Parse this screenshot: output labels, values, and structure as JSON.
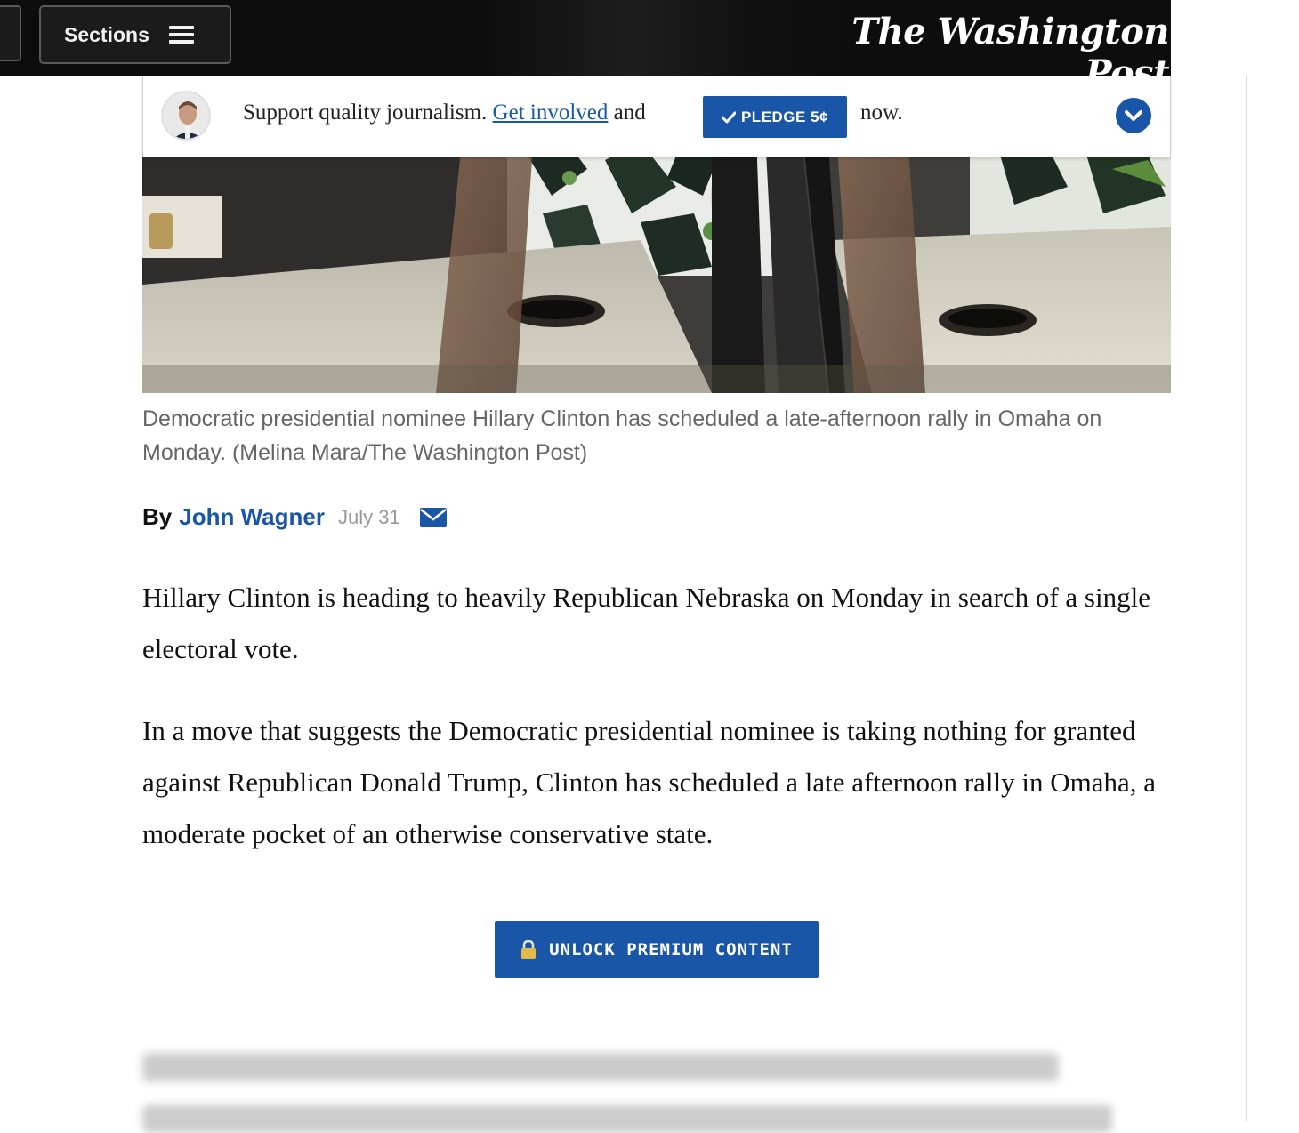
{
  "header": {
    "sections_label": "Sections",
    "logo_text": "The Washington Post"
  },
  "support_banner": {
    "text_before": "Support quality journalism. ",
    "link_text": "Get involved",
    "text_after": " and",
    "pledge_label": "PLEDGE 5¢",
    "text_end": "now."
  },
  "photo": {
    "caption": "Democratic presidential nominee Hillary Clinton has scheduled a late-afternoon rally in Omaha on Monday. (Melina Mara/The Washington Post)"
  },
  "byline": {
    "by_label": "By",
    "author": "John Wagner",
    "date": "July 31"
  },
  "article": {
    "paragraphs": [
      "Hillary Clinton is heading to heavily Republican Nebraska on Monday in search of a single electoral vote.",
      "In a move that suggests the Democratic presidential nominee is taking nothing for granted against Republican Donald Trump, Clinton has scheduled a late afternoon rally in Omaha, a moderate pocket of an otherwise conservative state."
    ]
  },
  "paywall": {
    "unlock_label": "UNLOCK PREMIUM CONTENT"
  },
  "colors": {
    "accent": "#1a56a8",
    "nav_bg": "#0d0d0d",
    "caption": "#666666"
  }
}
